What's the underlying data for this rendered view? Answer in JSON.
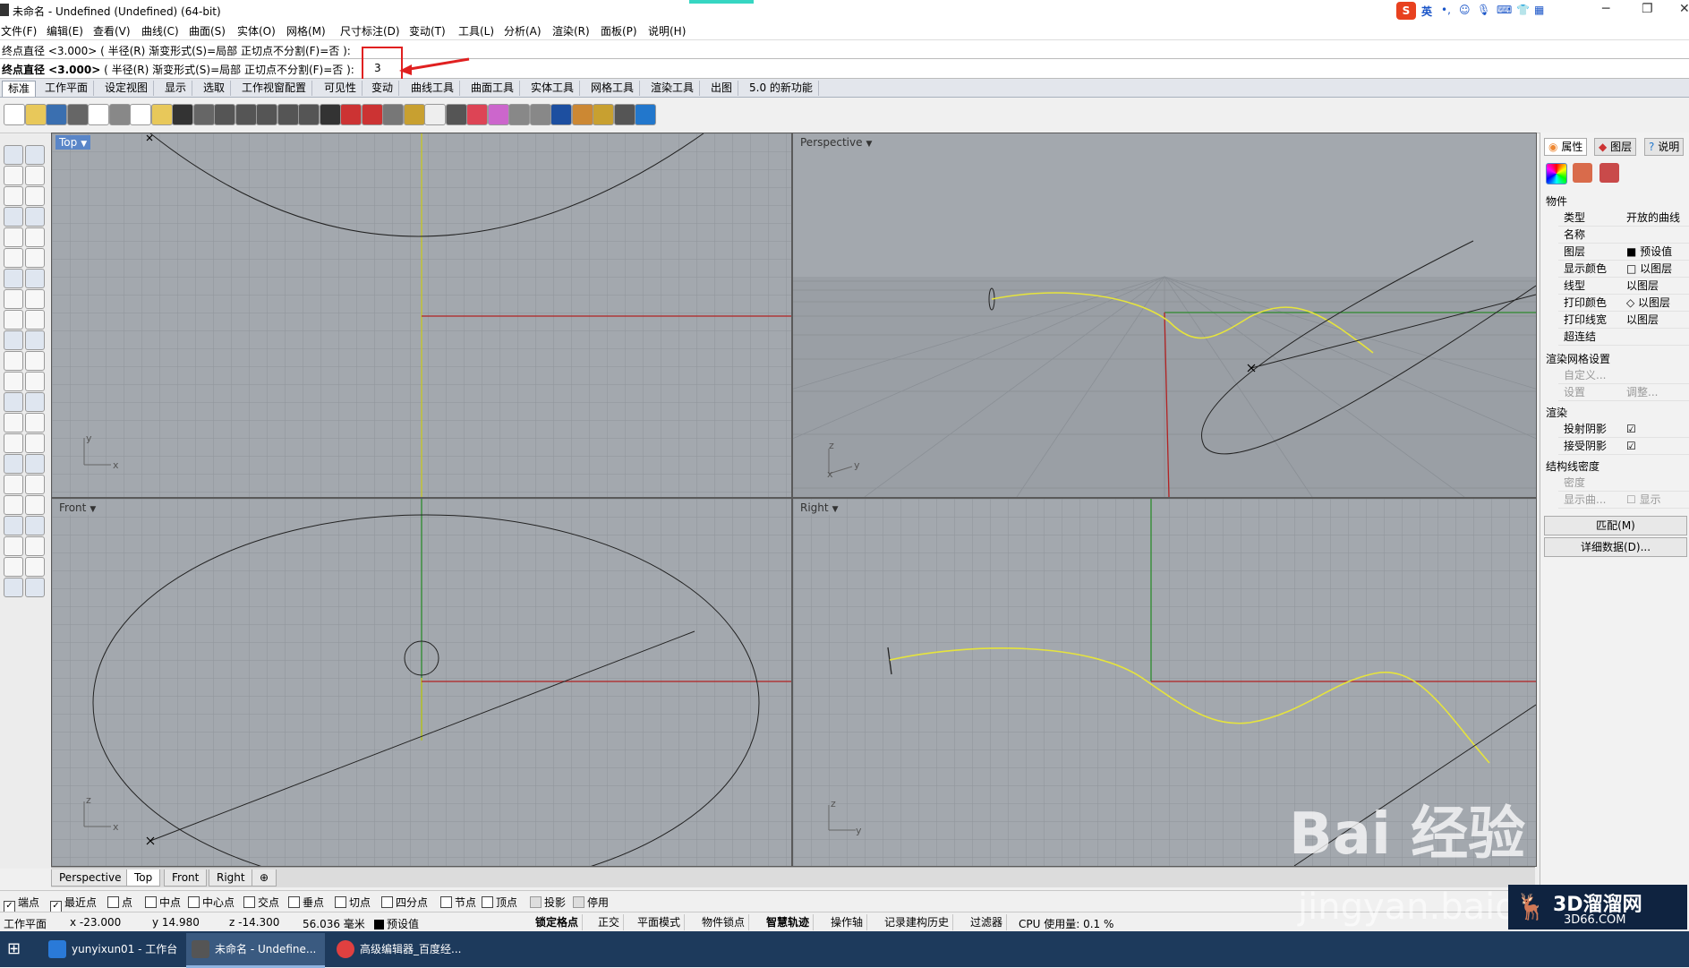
{
  "window": {
    "title": "未命名 - Undefined (Undefined) (64-bit)",
    "controls": [
      "─",
      "❐",
      "✕"
    ]
  },
  "ime": {
    "label": "英"
  },
  "menu": [
    "文件(F)",
    "编辑(E)",
    "查看(V)",
    "曲线(C)",
    "曲面(S)",
    "实体(O)",
    "网格(M)",
    "尺寸标注(D)",
    "变动(T)",
    "工具(L)",
    "分析(A)",
    "渲染(R)",
    "面板(P)",
    "说明(H)"
  ],
  "command": {
    "history": "终点直径 <3.000> ( 半径(R)  渐变形式(S)=局部  正切点不分割(F)=否 ):",
    "prompt_bold": "终点直径 <3.000>",
    "prompt_rest": "( 半径(R)  渐变形式(S)=局部  正切点不分割(F)=否 ):",
    "input": "3"
  },
  "tabs": [
    "标准",
    "工作平面",
    "设定视图",
    "显示",
    "选取",
    "工作视窗配置",
    "可见性",
    "变动",
    "曲线工具",
    "曲面工具",
    "实体工具",
    "网格工具",
    "渲染工具",
    "出图",
    "5.0 的新功能"
  ],
  "active_tab": "标准",
  "viewports": {
    "top": {
      "label": "Top"
    },
    "perspective": {
      "label": "Perspective"
    },
    "front": {
      "label": "Front"
    },
    "right": {
      "label": "Right"
    }
  },
  "viewport_tabs": [
    "Perspective",
    "Top",
    "Front",
    "Right"
  ],
  "viewport_tab_add": "⊕",
  "active_viewport_tab": "Top",
  "axis_labels": {
    "x": "x",
    "y": "y",
    "z": "z"
  },
  "snaps": [
    {
      "label": "端点",
      "checked": true
    },
    {
      "label": "最近点",
      "checked": true
    },
    {
      "label": "点",
      "checked": false
    },
    {
      "label": "中点",
      "checked": false
    },
    {
      "label": "中心点",
      "checked": false
    },
    {
      "label": "交点",
      "checked": false
    },
    {
      "label": "垂点",
      "checked": false
    },
    {
      "label": "切点",
      "checked": false
    },
    {
      "label": "四分点",
      "checked": false
    },
    {
      "label": "节点",
      "checked": false
    },
    {
      "label": "顶点",
      "checked": false
    },
    {
      "label": "投影",
      "checked": false
    },
    {
      "label": "停用",
      "checked": false
    }
  ],
  "status": {
    "cplane": "工作平面",
    "x": "x -23.000",
    "y": "y 14.980",
    "z": "z -14.300",
    "dist": "56.036 毫米",
    "layer": "预设值",
    "buttons": [
      "锁定格点",
      "正交",
      "平面模式",
      "物件锁点",
      "智慧轨迹",
      "操作轴",
      "记录建构历史",
      "过滤器"
    ],
    "cpu": "CPU 使用量: 0.1 %"
  },
  "panel": {
    "tabs": [
      "属性",
      "图层",
      "说明"
    ],
    "section_object": "物件",
    "rows": [
      {
        "k": "类型",
        "v": "开放的曲线"
      },
      {
        "k": "名称",
        "v": ""
      },
      {
        "k": "图层",
        "v": "■ 预设值"
      },
      {
        "k": "显示颜色",
        "v": "□ 以图层"
      },
      {
        "k": "线型",
        "v": "以图层"
      },
      {
        "k": "打印颜色",
        "v": "◇ 以图层"
      },
      {
        "k": "打印线宽",
        "v": "以图层"
      },
      {
        "k": "超连结",
        "v": ""
      }
    ],
    "section_mesh": "渲染网格设置",
    "mesh_rows": [
      {
        "k": "自定义...",
        "v": ""
      },
      {
        "k": "设置",
        "v": "调整..."
      }
    ],
    "section_render": "渲染",
    "render_rows": [
      {
        "k": "投射阴影",
        "v": "☑"
      },
      {
        "k": "接受阴影",
        "v": "☑"
      }
    ],
    "section_iso": "结构线密度",
    "iso_rows": [
      {
        "k": "密度",
        "v": ""
      },
      {
        "k": "显示曲...",
        "v": "☐ 显示"
      }
    ],
    "btn_match": "匹配(M)",
    "btn_details": "详细数据(D)..."
  },
  "taskbar": [
    {
      "label": "yunyixun01 - 工作台",
      "color": "#2a7ad8"
    },
    {
      "label": "未命名 - Undefine...",
      "color": "#555"
    },
    {
      "label": "高级编辑器_百度经...",
      "color": "#e04040"
    }
  ],
  "watermark": {
    "brand": "Bai 经验",
    "url": "jingyan.baidu",
    "logo_main": "3D溜溜网",
    "logo_sub": "3D66.COM"
  },
  "colors": {
    "viewport_bg": "#a3a8ae",
    "grid": "#8f949a",
    "grid_major": "#7e8389",
    "axis_x": "#b22222",
    "axis_y": "#2e8b2e",
    "axis_z_top": "#c8c820",
    "curve_selected": "#e6e43c",
    "curve": "#222222",
    "highlight_box": "#e02020"
  }
}
